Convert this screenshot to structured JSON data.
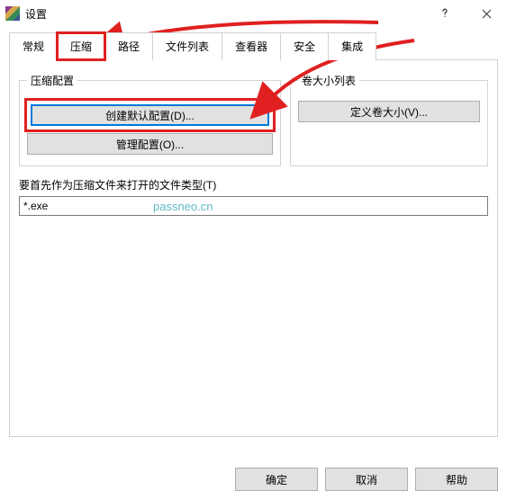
{
  "title": "设置",
  "tabs": {
    "general": "常规",
    "compression": "压缩",
    "paths": "路径",
    "filelist": "文件列表",
    "viewer": "查看器",
    "security": "安全",
    "integration": "集成"
  },
  "left_group": {
    "legend": "压缩配置",
    "create_default": "创建默认配置(D)...",
    "manage": "管理配置(O)..."
  },
  "right_group": {
    "legend": "卷大小列表",
    "define": "定义卷大小(V)..."
  },
  "file_type_label": "要首先作为压缩文件来打开的文件类型(T)",
  "file_type_value": "*.exe",
  "watermark": "passneo.cn",
  "buttons": {
    "ok": "确定",
    "cancel": "取消",
    "help": "帮助"
  }
}
